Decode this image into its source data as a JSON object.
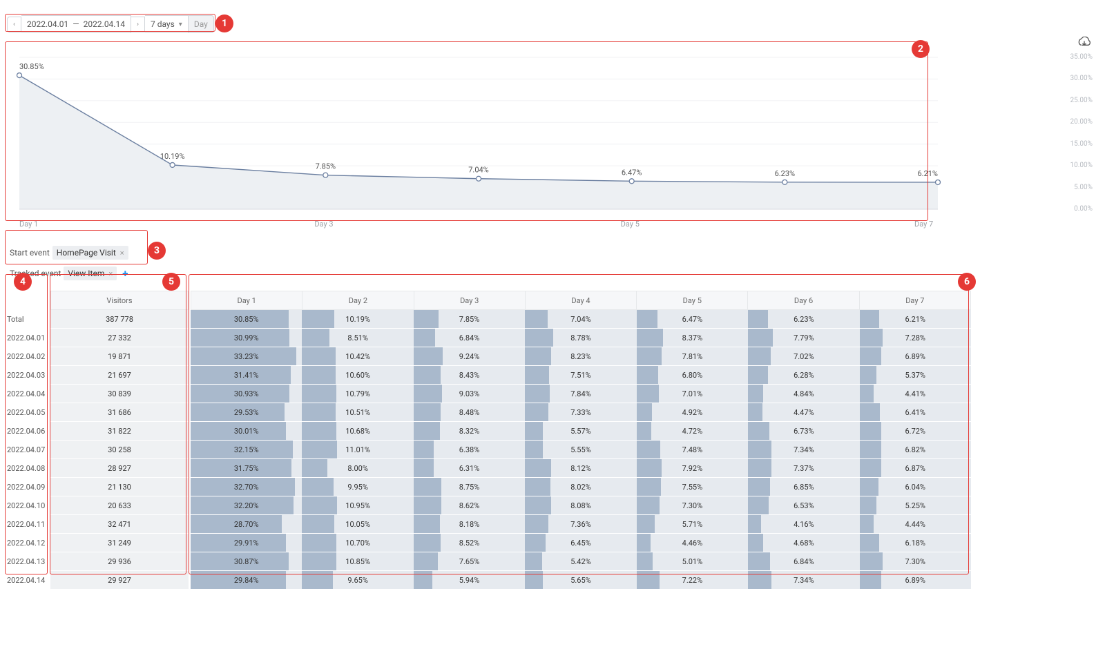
{
  "controls": {
    "date_from": "2022.04.01",
    "date_sep": "—",
    "date_to": "2022.04.14",
    "range_label": "7 days",
    "granularity": "Day"
  },
  "chart_data": {
    "type": "line",
    "title": "",
    "xlabel": "",
    "ylabel": "",
    "ylim": [
      0,
      35
    ],
    "y_ticks": [
      "0.00%",
      "5.00%",
      "10.00%",
      "15.00%",
      "20.00%",
      "25.00%",
      "30.00%",
      "35.00%"
    ],
    "x_ticks": [
      "Day 1",
      "Day 3",
      "Day 5",
      "Day 7"
    ],
    "categories": [
      "Day 1",
      "Day 2",
      "Day 3",
      "Day 4",
      "Day 5",
      "Day 6",
      "Day 7"
    ],
    "values": [
      30.85,
      10.19,
      7.85,
      7.04,
      6.47,
      6.23,
      6.21
    ],
    "point_labels": [
      "30.85%",
      "10.19%",
      "7.85%",
      "7.04%",
      "6.47%",
      "6.23%",
      "6.21%"
    ]
  },
  "events": {
    "start_label": "Start event",
    "start_chip": "HomePage Visit",
    "tracked_label": "Tracked event",
    "tracked_chip": "View Item"
  },
  "table": {
    "head_visitors": "Visitors",
    "day_headers": [
      "Day 1",
      "Day 2",
      "Day 3",
      "Day 4",
      "Day 5",
      "Day 6",
      "Day 7"
    ],
    "rows": [
      {
        "label": "Total",
        "visitors": "387 778",
        "days": [
          30.85,
          10.19,
          7.85,
          7.04,
          6.47,
          6.23,
          6.21
        ]
      },
      {
        "label": "2022.04.01",
        "visitors": "27 332",
        "days": [
          30.99,
          8.51,
          6.84,
          8.78,
          8.37,
          7.79,
          7.28
        ]
      },
      {
        "label": "2022.04.02",
        "visitors": "19 871",
        "days": [
          33.23,
          10.42,
          9.24,
          8.23,
          7.81,
          7.02,
          6.89
        ]
      },
      {
        "label": "2022.04.03",
        "visitors": "21 697",
        "days": [
          31.41,
          10.6,
          8.43,
          7.51,
          6.8,
          6.28,
          5.37
        ]
      },
      {
        "label": "2022.04.04",
        "visitors": "30 839",
        "days": [
          30.93,
          10.79,
          9.03,
          7.84,
          7.01,
          4.84,
          4.41
        ]
      },
      {
        "label": "2022.04.05",
        "visitors": "31 686",
        "days": [
          29.53,
          10.51,
          8.48,
          7.33,
          4.92,
          4.47,
          6.41
        ]
      },
      {
        "label": "2022.04.06",
        "visitors": "31 822",
        "days": [
          30.01,
          10.68,
          8.32,
          5.57,
          4.72,
          6.73,
          6.72
        ]
      },
      {
        "label": "2022.04.07",
        "visitors": "30 258",
        "days": [
          32.15,
          11.01,
          6.38,
          5.55,
          7.48,
          7.34,
          6.82
        ]
      },
      {
        "label": "2022.04.08",
        "visitors": "28 927",
        "days": [
          31.75,
          8.0,
          6.31,
          8.12,
          7.92,
          7.37,
          6.87
        ]
      },
      {
        "label": "2022.04.09",
        "visitors": "21 130",
        "days": [
          32.7,
          9.95,
          8.75,
          8.02,
          7.55,
          6.85,
          6.04
        ]
      },
      {
        "label": "2022.04.10",
        "visitors": "20 633",
        "days": [
          32.2,
          10.95,
          8.62,
          8.08,
          7.3,
          6.53,
          5.25
        ]
      },
      {
        "label": "2022.04.11",
        "visitors": "32 471",
        "days": [
          28.7,
          10.05,
          8.18,
          7.36,
          5.71,
          4.16,
          4.44
        ]
      },
      {
        "label": "2022.04.12",
        "visitors": "31 249",
        "days": [
          29.91,
          10.7,
          8.52,
          6.45,
          4.46,
          4.68,
          6.18
        ]
      },
      {
        "label": "2022.04.13",
        "visitors": "29 936",
        "days": [
          30.87,
          10.85,
          7.65,
          5.42,
          5.01,
          6.84,
          7.3
        ]
      },
      {
        "label": "2022.04.14",
        "visitors": "29 927",
        "days": [
          29.84,
          9.65,
          5.94,
          5.65,
          7.22,
          7.34,
          6.89
        ]
      }
    ]
  },
  "callouts": {
    "1": "1",
    "2": "2",
    "3": "3",
    "4": "4",
    "5": "5",
    "6": "6"
  }
}
